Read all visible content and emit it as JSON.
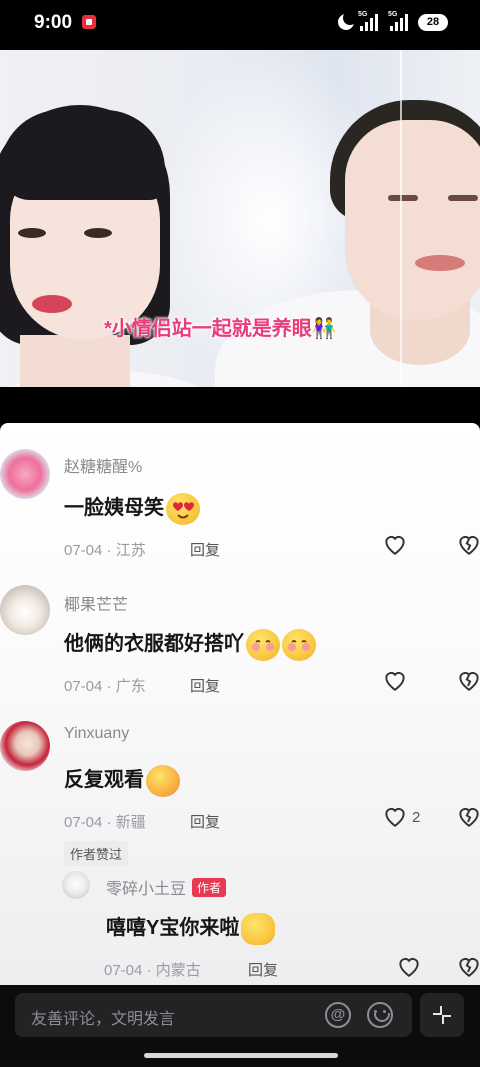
{
  "status_bar": {
    "time": "9:00",
    "network_1": "5G",
    "network_2": "5G",
    "battery": "28"
  },
  "video": {
    "caption": "*小情侣站一起就是养眼👫"
  },
  "comments": [
    {
      "username": "赵糖糖醒%",
      "text": "一脸姨母笑",
      "emoji": "heart-eyes",
      "date_location": "07-04 · 江苏",
      "reply_label": "回复",
      "like_count": ""
    },
    {
      "username": "椰果芒芒",
      "text": "他俩的衣服都好搭吖",
      "emoji": "blushing",
      "date_location": "07-04 · 广东",
      "reply_label": "回复",
      "like_count": ""
    },
    {
      "username": "Yinxuany",
      "text": "反复观看",
      "emoji": "dancing",
      "date_location": "07-04 · 新疆",
      "reply_label": "回复",
      "like_count": "2",
      "author_liked": "作者赞过"
    }
  ],
  "reply": {
    "username": "零碎小土豆",
    "badge": "作者",
    "text": "嘻嘻Y宝你来啦",
    "emoji": "heart-hands",
    "date_location": "07-04 · 内蒙古",
    "reply_label": "回复"
  },
  "input": {
    "placeholder": "友善评论，文明发言"
  },
  "colors": {
    "caption": "#e83d7a",
    "author_badge": "#e7394f",
    "username": "#8a8a8f"
  }
}
